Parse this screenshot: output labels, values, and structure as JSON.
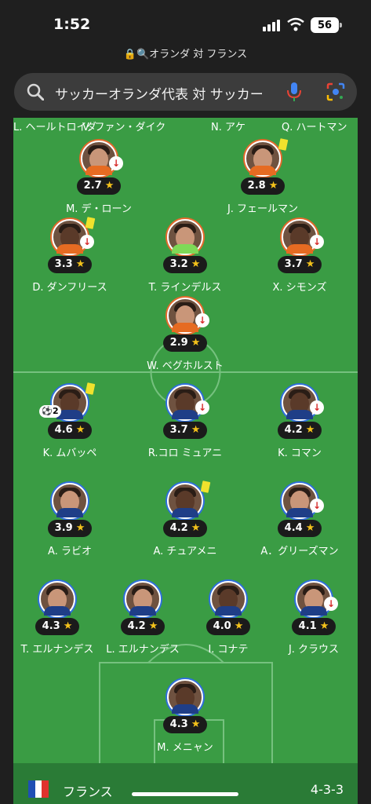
{
  "status": {
    "time": "1:52",
    "battery": "56",
    "wifi_icon": "wifi-icon",
    "signal_icon": "signal-icon"
  },
  "browser": {
    "url": "🔒🔍オランダ 対 フランス",
    "query": "サッカーオランダ代表 対 サッカー"
  },
  "icons": {
    "search": "search-icon",
    "mic": "mic-icon",
    "lens": "lens-icon",
    "sub": "↓",
    "card_color": "#f0e22d"
  },
  "top_names": [
    "L. ヘールトロイダ",
    "V. ファン・ダイク",
    "N. アケ",
    "Q. ハートマン"
  ],
  "netherlands": [
    {
      "name": "M. デ・ローン",
      "rating": "2.7",
      "sub": true,
      "card": false
    },
    {
      "name": "J. フェールマン",
      "rating": "2.8",
      "sub": false,
      "card": true
    },
    {
      "name": "D. ダンフリース",
      "rating": "3.3",
      "sub": true,
      "card": true
    },
    {
      "name": "T. ラインデルス",
      "rating": "3.2",
      "sub": false,
      "card": false
    },
    {
      "name": "X. シモンズ",
      "rating": "3.7",
      "sub": true,
      "card": false
    },
    {
      "name": "W. ベグホルスト",
      "rating": "2.9",
      "sub": true,
      "card": false
    }
  ],
  "france": [
    {
      "name": "K. ムバッペ",
      "rating": "4.6",
      "sub": false,
      "card": true,
      "badge": "2"
    },
    {
      "name": "R.コロ ミュアニ",
      "rating": "3.7",
      "sub": true,
      "card": false
    },
    {
      "name": "K. コマン",
      "rating": "4.2",
      "sub": true,
      "card": false
    },
    {
      "name": "A. ラビオ",
      "rating": "3.9",
      "sub": false,
      "card": false
    },
    {
      "name": "A. チュアメニ",
      "rating": "4.2",
      "sub": false,
      "card": true
    },
    {
      "name": "A．グリーズマン",
      "rating": "4.4",
      "sub": true,
      "card": false
    },
    {
      "name": "T. エルナンデス",
      "rating": "4.3",
      "sub": false,
      "card": false
    },
    {
      "name": "L. エルナンデス",
      "rating": "4.2",
      "sub": false,
      "card": false
    },
    {
      "name": "I. コナテ",
      "rating": "4.0",
      "sub": false,
      "card": false
    },
    {
      "name": "J. クラウス",
      "rating": "4.1",
      "sub": true,
      "card": false
    },
    {
      "name": "M. メニャン",
      "rating": "4.3",
      "sub": false,
      "card": false
    }
  ],
  "team_bar": {
    "team": "フランス",
    "formation": "4-3-3",
    "flag_colors": [
      "#1f4fb4",
      "#ffffff",
      "#e0322d"
    ]
  }
}
